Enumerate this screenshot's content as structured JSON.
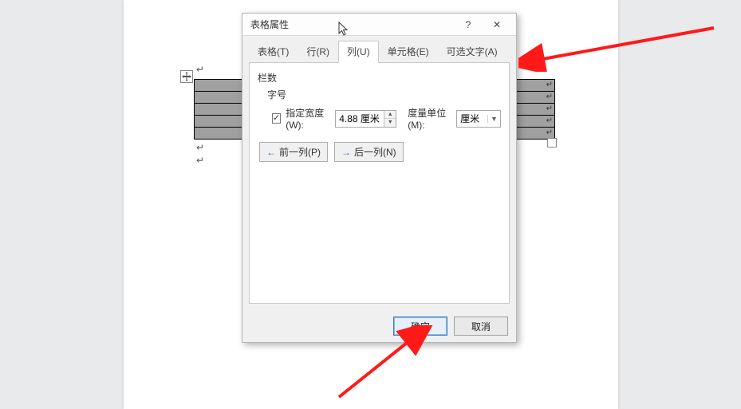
{
  "dialog": {
    "title": "表格属性",
    "help_symbol": "?",
    "close_symbol": "✕",
    "tabs": {
      "table": "表格(T)",
      "row": "行(R)",
      "column": "列(U)",
      "cell": "单元格(E)",
      "alt_text": "可选文字(A)"
    },
    "panel": {
      "group": "栏数",
      "subgroup": "字号",
      "specify_width_label": "指定宽度(W):",
      "width_value": "4.88 厘米",
      "measure_unit_label": "度量单位(M):",
      "unit_value": "厘米",
      "prev_col": "前一列(P)",
      "next_col": "后一列(N)"
    },
    "buttons": {
      "ok": "确定",
      "cancel": "取消"
    }
  },
  "doc": {
    "para_mark": "↵"
  }
}
